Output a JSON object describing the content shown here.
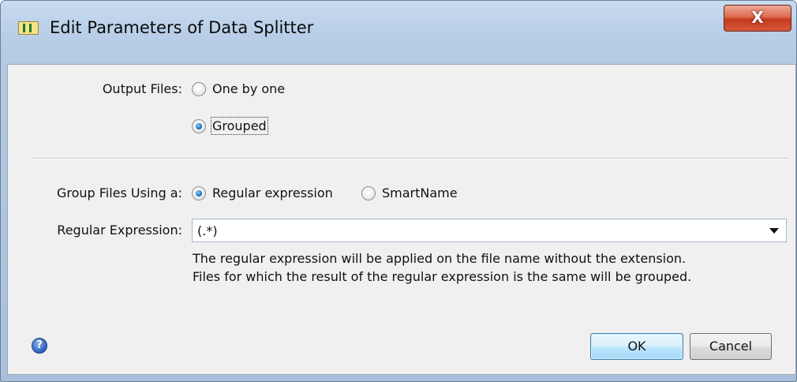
{
  "window": {
    "title": "Edit Parameters of Data Splitter",
    "close_label": "X"
  },
  "output_files": {
    "label": "Output Files:",
    "options": [
      {
        "label": "One by one",
        "selected": false
      },
      {
        "label": "Grouped",
        "selected": true
      }
    ]
  },
  "group_files": {
    "label": "Group Files Using a:",
    "options": [
      {
        "label": "Regular expression",
        "selected": true
      },
      {
        "label": "SmartName",
        "selected": false
      }
    ]
  },
  "regex": {
    "label": "Regular Expression:",
    "value": "(.*)",
    "hint_line1": "The regular expression will be applied on the file name without the extension.",
    "hint_line2": "Files for which the result of the regular expression is the same will be grouped."
  },
  "footer": {
    "help_icon": "?",
    "ok_label": "OK",
    "cancel_label": "Cancel"
  },
  "colors": {
    "title_gradient": "#b9cfe8",
    "close_button": "#c53a1e",
    "dialog_bg": "#f0f0f0",
    "radio_selected": "#1e6fbf",
    "ok_border": "#3c7fb1"
  }
}
